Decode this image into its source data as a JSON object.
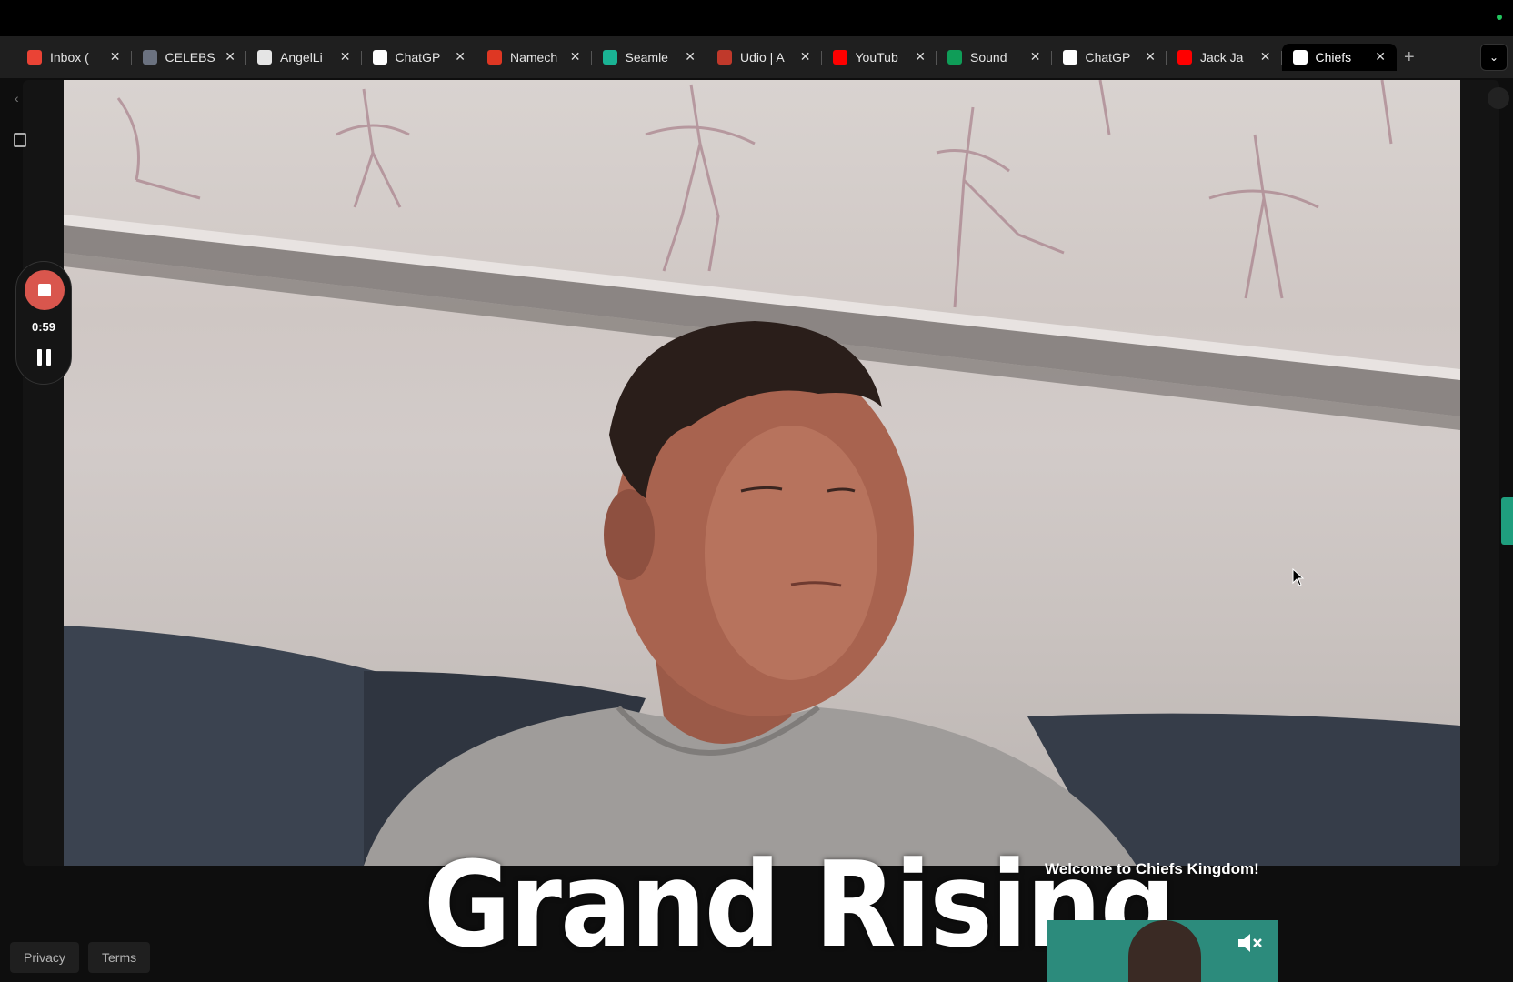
{
  "browser": {
    "tabs": [
      {
        "label": "Inbox (",
        "icon": "gmail-icon",
        "color": "#ea4335"
      },
      {
        "label": "CELEBS",
        "icon": "document-icon",
        "color": "#6b7280"
      },
      {
        "label": "AngelLi",
        "icon": "peace-hand-icon",
        "color": "#e5e5e5"
      },
      {
        "label": "ChatGP",
        "icon": "openai-icon",
        "color": "#ffffff"
      },
      {
        "label": "Namech",
        "icon": "namecheap-icon",
        "color": "#de3723"
      },
      {
        "label": "Seamle",
        "icon": "seamless-icon",
        "color": "#1ab394"
      },
      {
        "label": "Udio | A",
        "icon": "udio-icon",
        "color": "#c0392b"
      },
      {
        "label": "YouTub",
        "icon": "youtube-icon",
        "color": "#ff0000"
      },
      {
        "label": "Sound",
        "icon": "sheets-plus-icon",
        "color": "#0f9d58"
      },
      {
        "label": "ChatGP",
        "icon": "openai-icon",
        "color": "#ffffff"
      },
      {
        "label": "Jack Ja",
        "icon": "youtube-icon",
        "color": "#ff0000"
      },
      {
        "label": "Chiefs",
        "icon": "page-icon",
        "color": "#ffffff",
        "active": true
      }
    ],
    "close_glyph": "✕",
    "new_tab_glyph": "+",
    "tab_menu_glyph": "⌄"
  },
  "recorder": {
    "elapsed": "0:59",
    "stop_color": "#d9564d"
  },
  "overlay": {
    "caption": "Grand Rising",
    "welcome": "Welcome to Chiefs Kingdom!"
  },
  "footer": {
    "privacy": "Privacy",
    "terms": "Terms"
  }
}
